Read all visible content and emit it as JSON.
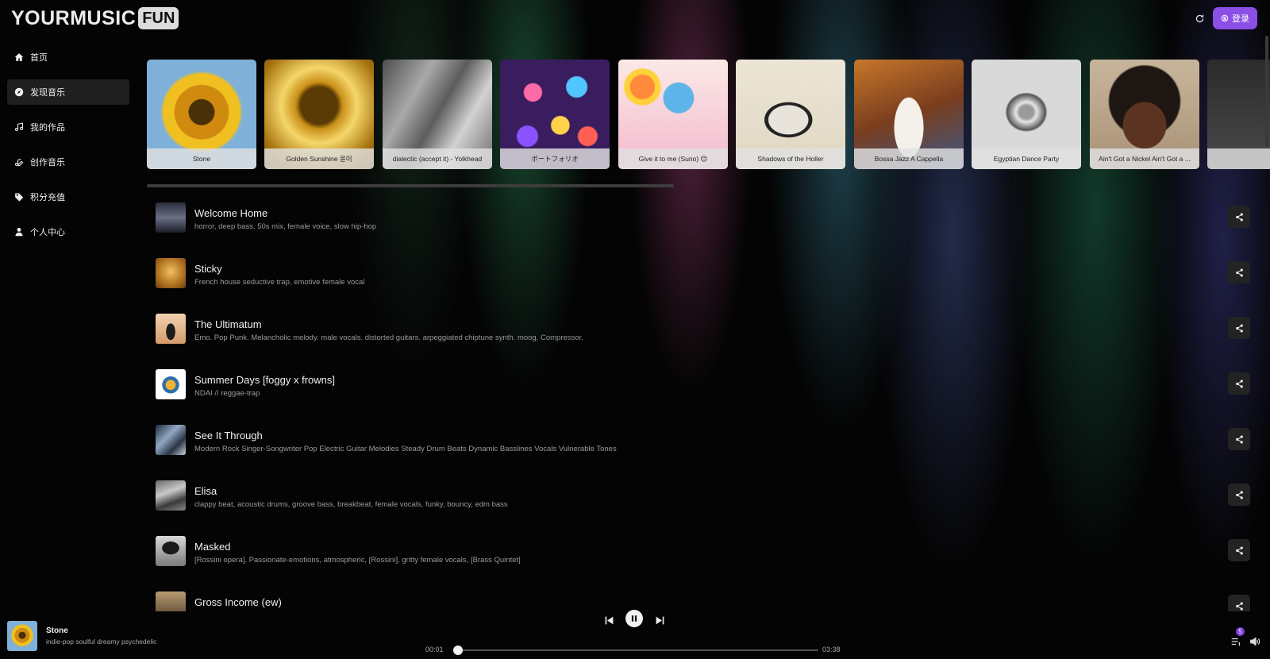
{
  "app": {
    "logo_text": "YOURMUSIC",
    "logo_badge": "FUN",
    "login_label": "登录"
  },
  "colors": {
    "accent": "#8b4fe6",
    "background": "#040404",
    "card_label_bg": "#e1e1e1"
  },
  "sidebar": {
    "items": [
      {
        "label": "首页",
        "icon": "home-icon"
      },
      {
        "label": "发现音乐",
        "icon": "compass-icon",
        "active": true
      },
      {
        "label": "我的作品",
        "icon": "music-note-icon"
      },
      {
        "label": "创作音乐",
        "icon": "create-music-icon"
      },
      {
        "label": "积分充值",
        "icon": "tag-icon"
      },
      {
        "label": "个人中心",
        "icon": "user-icon"
      }
    ]
  },
  "carousel": {
    "cards": [
      {
        "label": "Stone"
      },
      {
        "label": "Golden Sunshine 윤이"
      },
      {
        "label": "dialectic (accept it) - Yolkhead"
      },
      {
        "label": "ポートフォリオ"
      },
      {
        "label": "Give it to me (Suno) 😊"
      },
      {
        "label": "Shadows of the Holler"
      },
      {
        "label": "Bossa Jazz A Cappella"
      },
      {
        "label": "Egyptian Dance Party"
      },
      {
        "label": "Ain't Got a Nickel Ain't Got a ..."
      },
      {
        "label": ""
      }
    ]
  },
  "songs": [
    {
      "title": "Welcome Home",
      "tags": "horror, deep bass, 50s mix, female voice, slow hip-hop"
    },
    {
      "title": "Sticky",
      "tags": "French house seductive trap, emotive female vocal"
    },
    {
      "title": "The Ultimatum",
      "tags": "Emo. Pop Punk. Melancholic melody. male vocals. distorted guitars. arpeggiated chiptune synth. moog. Compressor."
    },
    {
      "title": "Summer Days [foggy x frowns]",
      "tags": "NDAI // reggae-trap"
    },
    {
      "title": "See It Through",
      "tags": "Modern Rock Singer-Songwriter Pop Electric Guitar Melodies Steady Drum Beats Dynamic Basslines Vocals Vulnerable Tones"
    },
    {
      "title": "Elisa",
      "tags": "clappy beat, acoustic drums, groove bass, breakbeat, female vocals, funky, bouncy, edm bass"
    },
    {
      "title": "Masked",
      "tags": "[Rossini opera], Passionate-emotions, atmospheric, [Rossini], gritty female vocals, [Brass Quintet]"
    },
    {
      "title": "Gross Income (ew)",
      "tags": ""
    }
  ],
  "player": {
    "title": "Stone",
    "subtitle": "indie-pop soulful dreamy psychedelic",
    "current_time": "00:01",
    "total_time": "03:38",
    "progress_fraction": 0.005,
    "queue_count": "5"
  }
}
